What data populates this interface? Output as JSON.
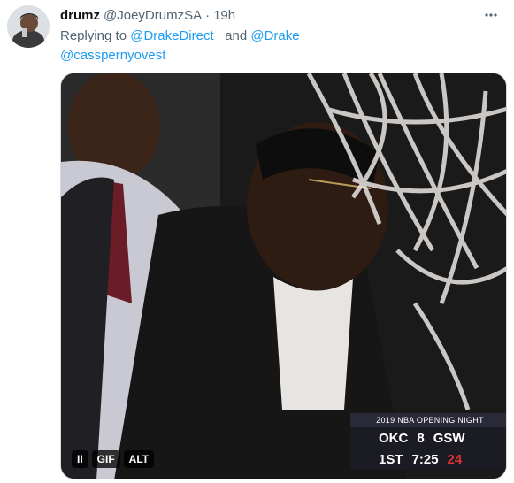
{
  "tweet": {
    "author_name": "drumz",
    "author_handle": "@JoeyDrumzSA",
    "separator": "·",
    "time": "19h",
    "more_icon": "more-horizontal-icon",
    "replying_prefix": "Replying to",
    "mention_1": "@DrakeDirect_",
    "and": "and",
    "mention_2": "@Drake",
    "mention_3": "@casspernyovest"
  },
  "media": {
    "pause_label": "II",
    "gif_label": "GIF",
    "alt_label": "ALT",
    "scorebug": {
      "banner": "2019 NBA OPENING NIGHT",
      "team_home": "OKC",
      "score_home": "8",
      "team_away": "GSW",
      "period": "1ST",
      "clock": "7:25",
      "shot_clock": "24"
    }
  },
  "colors": {
    "link": "#1d9bf0",
    "text": "#0f1419",
    "muted": "#536471"
  }
}
